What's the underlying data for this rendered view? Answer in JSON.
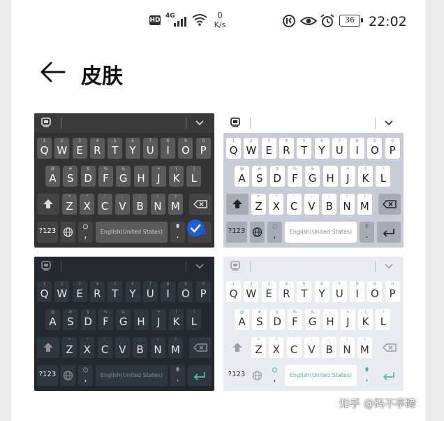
{
  "status_bar": {
    "hd_label": "HD",
    "network_label": "4G",
    "speed_value": "0",
    "speed_unit": "K/s",
    "battery_level": "36",
    "time": "22:02"
  },
  "header": {
    "title": "皮肤"
  },
  "keyboard": {
    "row1": [
      {
        "hint": "1",
        "char": "Q"
      },
      {
        "hint": "2",
        "char": "W"
      },
      {
        "hint": "3",
        "char": "E"
      },
      {
        "hint": "4",
        "char": "R"
      },
      {
        "hint": "5",
        "char": "T"
      },
      {
        "hint": "6",
        "char": "Y"
      },
      {
        "hint": "7",
        "char": "U"
      },
      {
        "hint": "8",
        "char": "I"
      },
      {
        "hint": "9",
        "char": "O"
      },
      {
        "hint": "0",
        "char": "P"
      }
    ],
    "row2": [
      {
        "hint": "@",
        "char": "A"
      },
      {
        "hint": "#",
        "char": "S"
      },
      {
        "hint": "$",
        "char": "D"
      },
      {
        "hint": "%",
        "char": "F"
      },
      {
        "hint": "&",
        "char": "G"
      },
      {
        "hint": "-",
        "char": "H"
      },
      {
        "hint": "+",
        "char": "J"
      },
      {
        "hint": "(",
        "char": "K"
      },
      {
        "hint": ")",
        "char": "L"
      }
    ],
    "row3": [
      {
        "hint": "*",
        "char": "Z"
      },
      {
        "hint": "\"",
        "char": "X"
      },
      {
        "hint": "'",
        "char": "C"
      },
      {
        "hint": ":",
        "char": "V"
      },
      {
        "hint": ";",
        "char": "B"
      },
      {
        "hint": "!",
        "char": "N"
      },
      {
        "hint": "?",
        "char": "M"
      }
    ],
    "symbols_label": "?123",
    "comma_label": ",",
    "period_label": ".",
    "space_label": "English(United States)"
  },
  "themes": [
    {
      "id": "dark-gray",
      "selected": true,
      "colors": {
        "bg": "#333333",
        "bar": "#3a3a3a",
        "key": "#5a5a5a",
        "fn": "#444444",
        "text": "#ffffff",
        "hint": "#d0d0d0",
        "icon": "#dddddd",
        "enter": "#1a5fe0"
      }
    },
    {
      "id": "light-gray",
      "selected": false,
      "colors": {
        "bg": "#c8ccd6",
        "bar": "#ffffff",
        "key": "#ffffff",
        "fn": "#a7abb6",
        "text": "#222222",
        "hint": "#888888",
        "icon": "#222222",
        "enter": "#222222"
      }
    },
    {
      "id": "dark-slate",
      "selected": false,
      "colors": {
        "bg": "#222a2f",
        "bar": "#222a2f",
        "key": "#2e373d",
        "fn": "#2e373d",
        "text": "#e8e8e8",
        "hint": "#888e92",
        "icon": "#8a9094",
        "enter": "#3fc6a6"
      }
    },
    {
      "id": "light-pale",
      "selected": false,
      "colors": {
        "bg": "#e9ecf0",
        "bar": "#e9ecf0",
        "key": "#ffffff",
        "fn": "#e9ecf0",
        "text": "#333333",
        "hint": "#3fb89a",
        "icon": "#9aa0a6",
        "enter": "#3fc6a6"
      }
    }
  ],
  "watermark": "知乎 @码不亭蹄"
}
